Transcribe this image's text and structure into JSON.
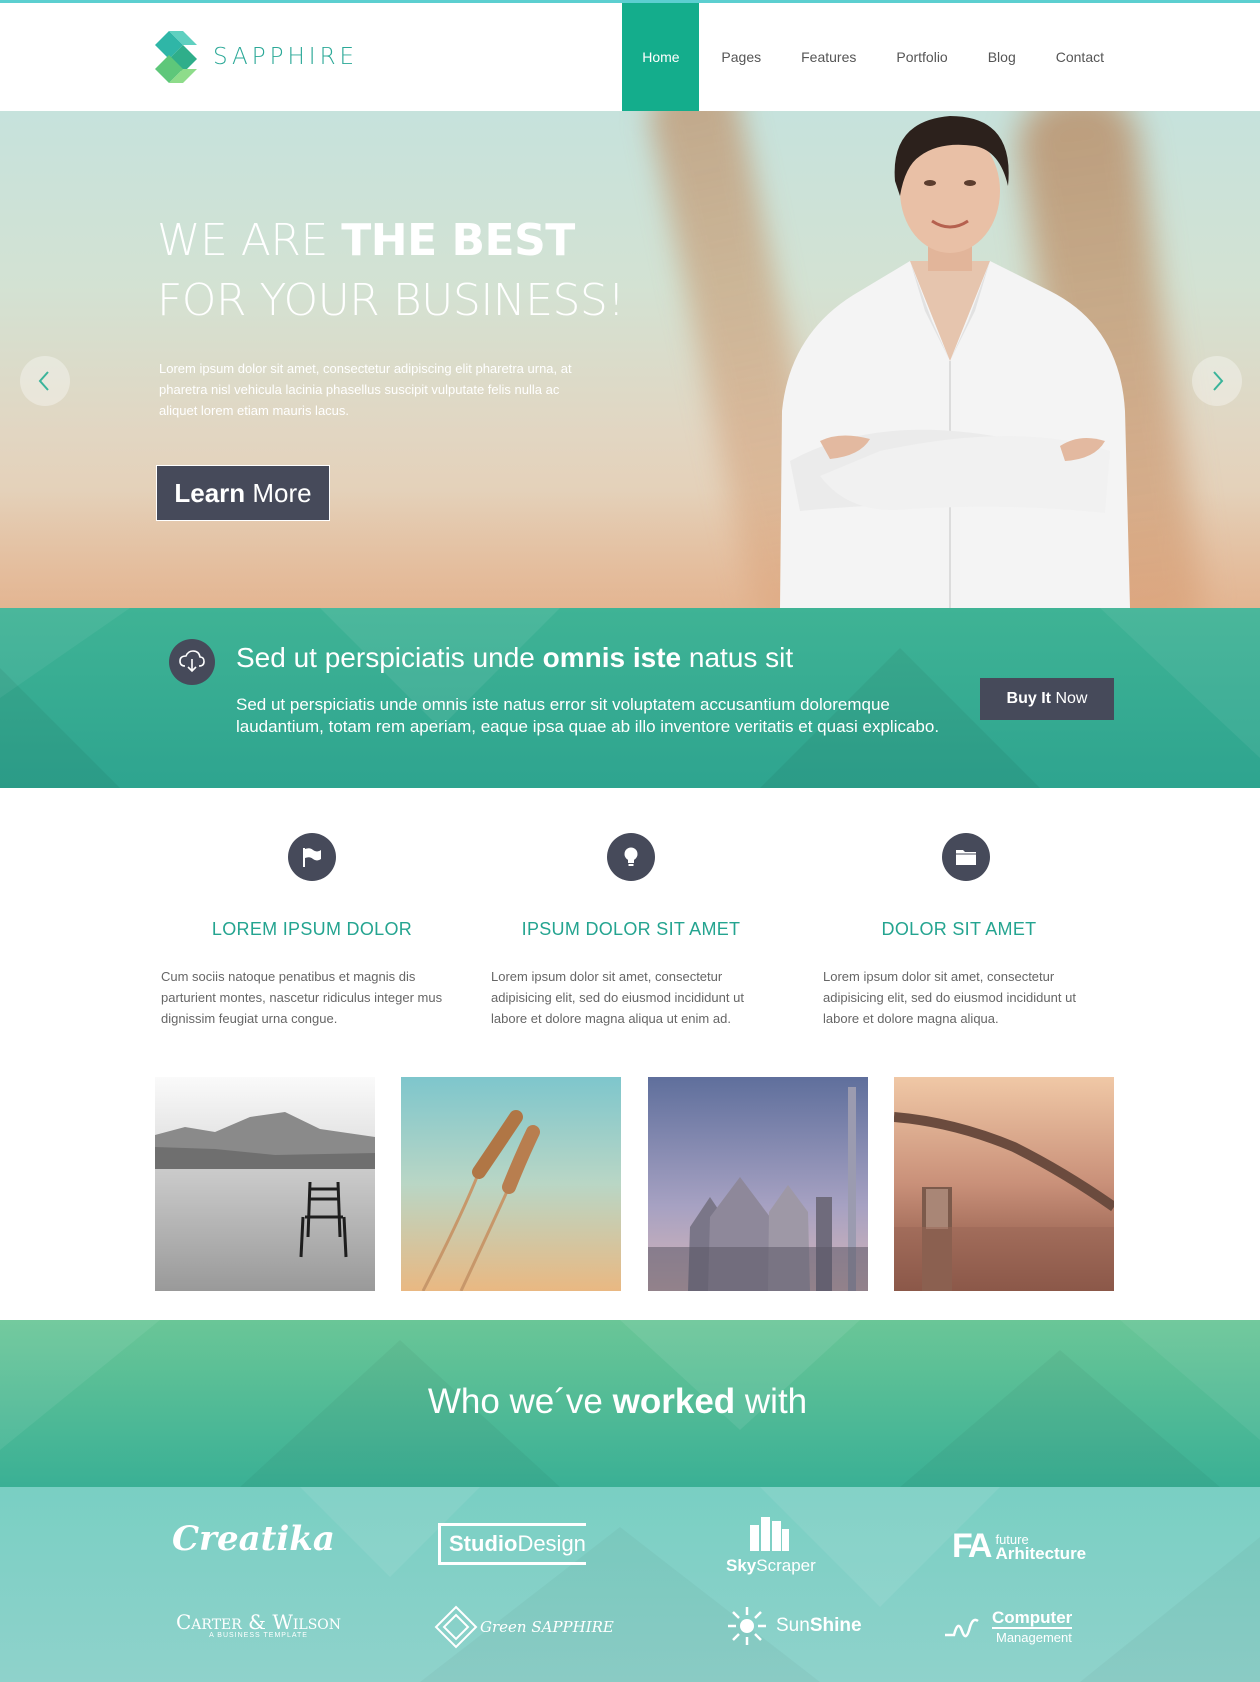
{
  "brand": {
    "name": "SAPPHIRE"
  },
  "nav": {
    "items": [
      {
        "label": "Home"
      },
      {
        "label": "Pages"
      },
      {
        "label": "Features"
      },
      {
        "label": "Portfolio"
      },
      {
        "label": "Blog"
      },
      {
        "label": "Contact"
      }
    ],
    "active": "Home"
  },
  "hero": {
    "title_line1_light": "WE ARE ",
    "title_line1_bold": "THE BEST",
    "title_line2": "FOR YOUR BUSINESS!",
    "text": "Lorem ipsum dolor sit amet, consectetur adipiscing elit pharetra urna, at pharetra nisl vehicula lacinia phasellus suscipit vulputate felis nulla ac aliquet lorem etiam mauris lacus.",
    "button_bold": "Learn",
    "button_light": " More"
  },
  "banner": {
    "title_a": "Sed ut perspiciatis unde ",
    "title_bold": "omnis iste",
    "title_b": " natus sit",
    "text": "Sed ut perspiciatis unde omnis iste natus error sit voluptatem accusantium doloremque laudantium, totam rem aperiam, eaque ipsa quae ab illo inventore veritatis et quasi explicabo.",
    "button_bold": "Buy It",
    "button_light": " Now"
  },
  "features": [
    {
      "icon": "flag-icon",
      "title": "LOREM IPSUM DOLOR",
      "text": "Cum sociis natoque penatibus et magnis dis parturient montes, nascetur ridiculus integer mus dignissim feugiat urna congue."
    },
    {
      "icon": "lightbulb-icon",
      "title": "IPSUM DOLOR SIT AMET",
      "text": "Lorem ipsum dolor sit amet, consectetur adipisicing elit, sed do eiusmod incididunt ut labore et dolore magna aliqua ut enim ad."
    },
    {
      "icon": "folder-icon",
      "title": "DOLOR SIT AMET",
      "text": "Lorem ipsum dolor sit amet, consectetur adipisicing elit, sed do eiusmod incididunt ut labore et dolore magna aliqua."
    }
  ],
  "work": {
    "title_a": "Who we´ve ",
    "title_bold": "worked",
    "title_b": " with"
  },
  "clients": {
    "creatika": "Creatika",
    "studio_a": "Studio",
    "studio_b": "Design",
    "sky_a": "Sky",
    "sky_b": "Scraper",
    "fa_mark": "FA",
    "fa_small": "future",
    "fa_big": "Arhitecture",
    "carter": "Carter & Wilson",
    "carter_sub": "A BUSINESS TEMPLATE",
    "green": "Green SAPPHIRE",
    "sun_a": "Sun",
    "sun_b": "Shine",
    "comp_a": "Computer",
    "comp_b": "Management"
  },
  "colors": {
    "accent": "#14ad8c",
    "dark_button": "#464a5a",
    "teal_heading": "#24a490"
  }
}
